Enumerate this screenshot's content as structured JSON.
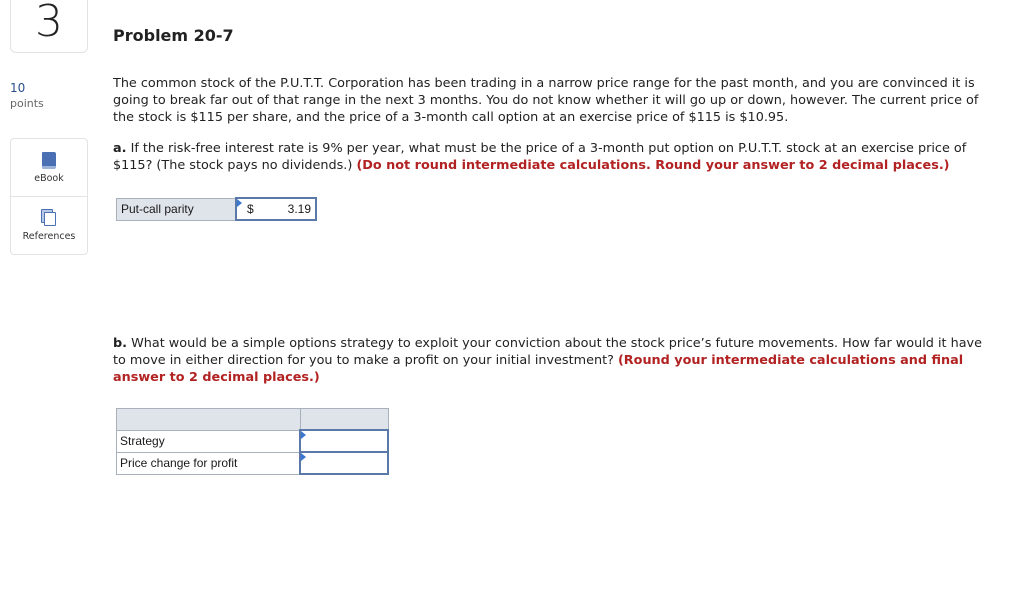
{
  "question_number": "3",
  "problem_title": "Problem 20-7",
  "points": {
    "value": "10",
    "label": "points"
  },
  "tools": [
    {
      "icon": "book-icon",
      "label": "eBook"
    },
    {
      "icon": "references-icon",
      "label": "References"
    }
  ],
  "intro": "The common stock of the P.U.T.T. Corporation has been trading in a narrow price range for the past month, and you are convinced it is going to break far out of that range in the next 3 months. You do not know whether it will go up or down, however. The current price of the stock is $115 per share, and the price of a 3-month call option at an exercise price of $115 is $10.95.",
  "part_a": {
    "letter": "a.",
    "text": " If the risk-free interest rate is 9% per year, what must be the price of a 3-month put option on P.U.T.T. stock at an exercise price of $115? (The stock pays no dividends.) ",
    "instruction": "(Do not round intermediate calculations. Round your answer to 2 decimal places.)",
    "row_label": "Put-call parity",
    "currency": "$",
    "answer": "3.19"
  },
  "part_b": {
    "letter": "b.",
    "text": " What would be a simple options strategy to exploit your conviction about the stock price’s future movements. How far would it have to move in either direction for you to make a profit on your initial investment? ",
    "instruction": "(Round your intermediate calculations and final answer to 2 decimal places.)",
    "rows": [
      {
        "label": "Strategy",
        "value": ""
      },
      {
        "label": "Price change for profit",
        "value": ""
      }
    ]
  }
}
